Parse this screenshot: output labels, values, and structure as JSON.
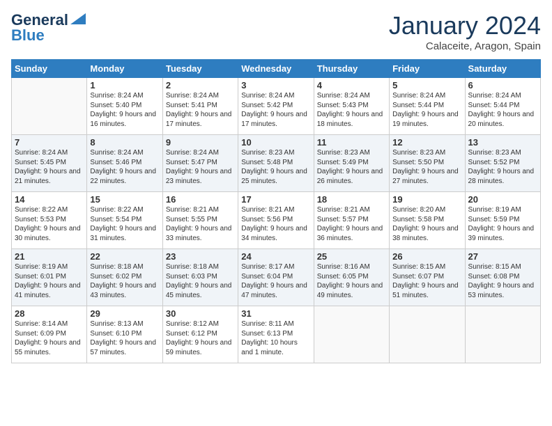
{
  "header": {
    "logo_line1": "General",
    "logo_line2": "Blue",
    "month": "January 2024",
    "location": "Calaceite, Aragon, Spain"
  },
  "days_of_week": [
    "Sunday",
    "Monday",
    "Tuesday",
    "Wednesday",
    "Thursday",
    "Friday",
    "Saturday"
  ],
  "weeks": [
    [
      {
        "day": "",
        "sunrise": "",
        "sunset": "",
        "daylight": ""
      },
      {
        "day": "1",
        "sunrise": "Sunrise: 8:24 AM",
        "sunset": "Sunset: 5:40 PM",
        "daylight": "Daylight: 9 hours and 16 minutes."
      },
      {
        "day": "2",
        "sunrise": "Sunrise: 8:24 AM",
        "sunset": "Sunset: 5:41 PM",
        "daylight": "Daylight: 9 hours and 17 minutes."
      },
      {
        "day": "3",
        "sunrise": "Sunrise: 8:24 AM",
        "sunset": "Sunset: 5:42 PM",
        "daylight": "Daylight: 9 hours and 17 minutes."
      },
      {
        "day": "4",
        "sunrise": "Sunrise: 8:24 AM",
        "sunset": "Sunset: 5:43 PM",
        "daylight": "Daylight: 9 hours and 18 minutes."
      },
      {
        "day": "5",
        "sunrise": "Sunrise: 8:24 AM",
        "sunset": "Sunset: 5:44 PM",
        "daylight": "Daylight: 9 hours and 19 minutes."
      },
      {
        "day": "6",
        "sunrise": "Sunrise: 8:24 AM",
        "sunset": "Sunset: 5:44 PM",
        "daylight": "Daylight: 9 hours and 20 minutes."
      }
    ],
    [
      {
        "day": "7",
        "sunrise": "Sunrise: 8:24 AM",
        "sunset": "Sunset: 5:45 PM",
        "daylight": "Daylight: 9 hours and 21 minutes."
      },
      {
        "day": "8",
        "sunrise": "Sunrise: 8:24 AM",
        "sunset": "Sunset: 5:46 PM",
        "daylight": "Daylight: 9 hours and 22 minutes."
      },
      {
        "day": "9",
        "sunrise": "Sunrise: 8:24 AM",
        "sunset": "Sunset: 5:47 PM",
        "daylight": "Daylight: 9 hours and 23 minutes."
      },
      {
        "day": "10",
        "sunrise": "Sunrise: 8:23 AM",
        "sunset": "Sunset: 5:48 PM",
        "daylight": "Daylight: 9 hours and 25 minutes."
      },
      {
        "day": "11",
        "sunrise": "Sunrise: 8:23 AM",
        "sunset": "Sunset: 5:49 PM",
        "daylight": "Daylight: 9 hours and 26 minutes."
      },
      {
        "day": "12",
        "sunrise": "Sunrise: 8:23 AM",
        "sunset": "Sunset: 5:50 PM",
        "daylight": "Daylight: 9 hours and 27 minutes."
      },
      {
        "day": "13",
        "sunrise": "Sunrise: 8:23 AM",
        "sunset": "Sunset: 5:52 PM",
        "daylight": "Daylight: 9 hours and 28 minutes."
      }
    ],
    [
      {
        "day": "14",
        "sunrise": "Sunrise: 8:22 AM",
        "sunset": "Sunset: 5:53 PM",
        "daylight": "Daylight: 9 hours and 30 minutes."
      },
      {
        "day": "15",
        "sunrise": "Sunrise: 8:22 AM",
        "sunset": "Sunset: 5:54 PM",
        "daylight": "Daylight: 9 hours and 31 minutes."
      },
      {
        "day": "16",
        "sunrise": "Sunrise: 8:21 AM",
        "sunset": "Sunset: 5:55 PM",
        "daylight": "Daylight: 9 hours and 33 minutes."
      },
      {
        "day": "17",
        "sunrise": "Sunrise: 8:21 AM",
        "sunset": "Sunset: 5:56 PM",
        "daylight": "Daylight: 9 hours and 34 minutes."
      },
      {
        "day": "18",
        "sunrise": "Sunrise: 8:21 AM",
        "sunset": "Sunset: 5:57 PM",
        "daylight": "Daylight: 9 hours and 36 minutes."
      },
      {
        "day": "19",
        "sunrise": "Sunrise: 8:20 AM",
        "sunset": "Sunset: 5:58 PM",
        "daylight": "Daylight: 9 hours and 38 minutes."
      },
      {
        "day": "20",
        "sunrise": "Sunrise: 8:19 AM",
        "sunset": "Sunset: 5:59 PM",
        "daylight": "Daylight: 9 hours and 39 minutes."
      }
    ],
    [
      {
        "day": "21",
        "sunrise": "Sunrise: 8:19 AM",
        "sunset": "Sunset: 6:01 PM",
        "daylight": "Daylight: 9 hours and 41 minutes."
      },
      {
        "day": "22",
        "sunrise": "Sunrise: 8:18 AM",
        "sunset": "Sunset: 6:02 PM",
        "daylight": "Daylight: 9 hours and 43 minutes."
      },
      {
        "day": "23",
        "sunrise": "Sunrise: 8:18 AM",
        "sunset": "Sunset: 6:03 PM",
        "daylight": "Daylight: 9 hours and 45 minutes."
      },
      {
        "day": "24",
        "sunrise": "Sunrise: 8:17 AM",
        "sunset": "Sunset: 6:04 PM",
        "daylight": "Daylight: 9 hours and 47 minutes."
      },
      {
        "day": "25",
        "sunrise": "Sunrise: 8:16 AM",
        "sunset": "Sunset: 6:05 PM",
        "daylight": "Daylight: 9 hours and 49 minutes."
      },
      {
        "day": "26",
        "sunrise": "Sunrise: 8:15 AM",
        "sunset": "Sunset: 6:07 PM",
        "daylight": "Daylight: 9 hours and 51 minutes."
      },
      {
        "day": "27",
        "sunrise": "Sunrise: 8:15 AM",
        "sunset": "Sunset: 6:08 PM",
        "daylight": "Daylight: 9 hours and 53 minutes."
      }
    ],
    [
      {
        "day": "28",
        "sunrise": "Sunrise: 8:14 AM",
        "sunset": "Sunset: 6:09 PM",
        "daylight": "Daylight: 9 hours and 55 minutes."
      },
      {
        "day": "29",
        "sunrise": "Sunrise: 8:13 AM",
        "sunset": "Sunset: 6:10 PM",
        "daylight": "Daylight: 9 hours and 57 minutes."
      },
      {
        "day": "30",
        "sunrise": "Sunrise: 8:12 AM",
        "sunset": "Sunset: 6:12 PM",
        "daylight": "Daylight: 9 hours and 59 minutes."
      },
      {
        "day": "31",
        "sunrise": "Sunrise: 8:11 AM",
        "sunset": "Sunset: 6:13 PM",
        "daylight": "Daylight: 10 hours and 1 minute."
      },
      {
        "day": "",
        "sunrise": "",
        "sunset": "",
        "daylight": ""
      },
      {
        "day": "",
        "sunrise": "",
        "sunset": "",
        "daylight": ""
      },
      {
        "day": "",
        "sunrise": "",
        "sunset": "",
        "daylight": ""
      }
    ]
  ]
}
